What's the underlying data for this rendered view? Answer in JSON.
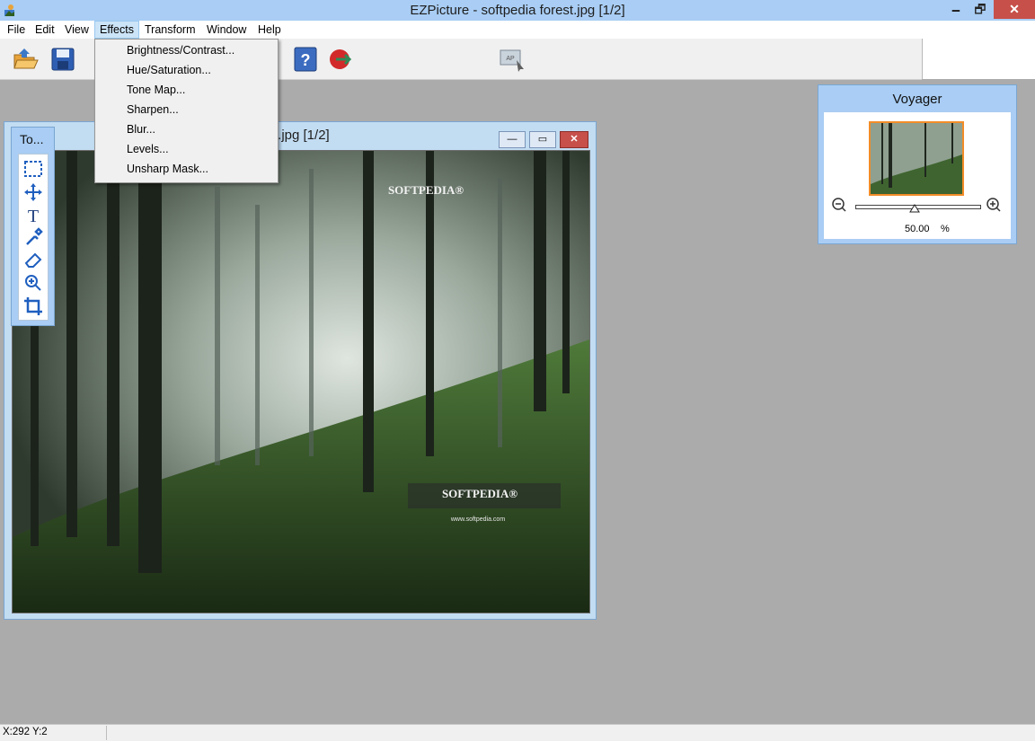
{
  "window": {
    "title": "EZPicture - softpedia forest.jpg [1/2]",
    "minimize": "🗕",
    "maximize": "🗗",
    "close": "✕"
  },
  "menu": [
    "File",
    "Edit",
    "View",
    "Effects",
    "Transform",
    "Window",
    "Help"
  ],
  "active_menu": "Effects",
  "effects_menu": [
    "Brightness/Contrast...",
    "Hue/Saturation...",
    "Tone Map...",
    "Sharpen...",
    "Blur...",
    "Levels...",
    "Unsharp Mask..."
  ],
  "toolbar_icons": [
    "open-icon",
    "save-icon",
    "help-icon",
    "web-icon",
    "screen-capture-icon"
  ],
  "document": {
    "title": "t.jpg [1/2]",
    "watermark_top": "SOFTPEDIA®",
    "watermark_bottom": "SOFTPEDIA®",
    "watermark_url": "www.softpedia.com"
  },
  "tools": {
    "title": "To...",
    "items": [
      "rectangle-select-icon",
      "move-icon",
      "text-icon",
      "eyedropper-icon",
      "eraser-icon",
      "zoom-icon",
      "crop-icon"
    ]
  },
  "voyager": {
    "title": "Voyager",
    "zoom_value": "50.00",
    "zoom_unit": "%"
  },
  "status": {
    "coords": "X:292   Y:2"
  },
  "colors": {
    "title_bar": "#a9cdf4",
    "close_button": "#c7504a",
    "workspace": "#ababab",
    "voyager_highlight": "#f28c28"
  }
}
